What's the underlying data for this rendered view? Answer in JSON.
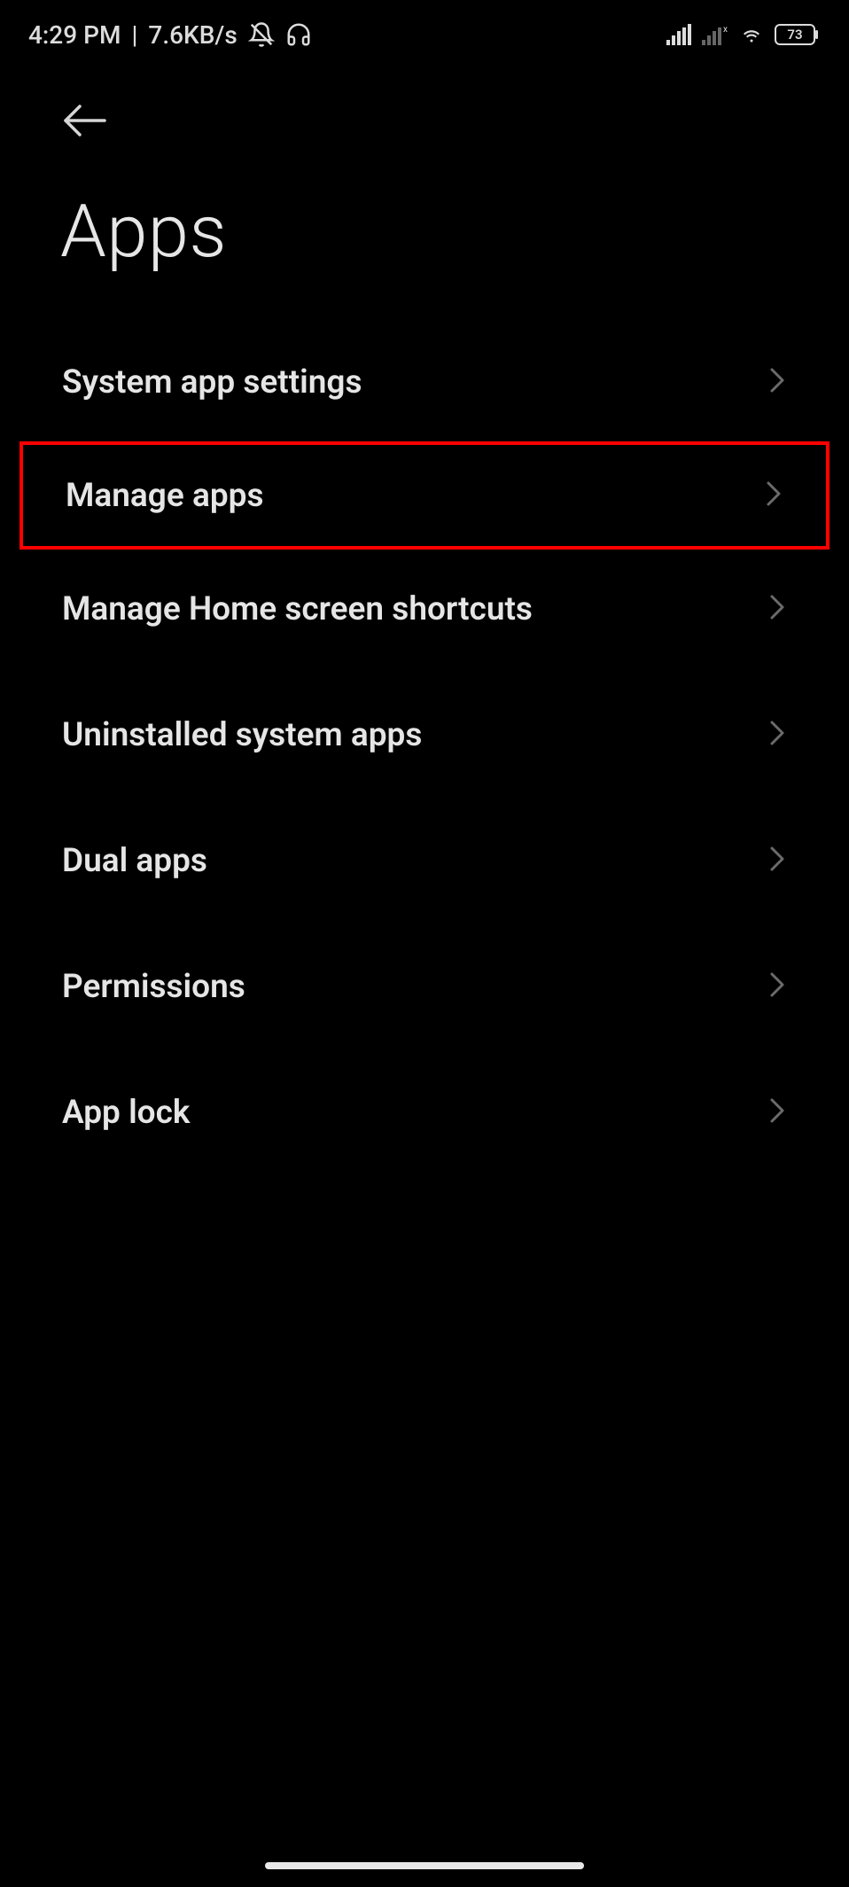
{
  "status_bar": {
    "time": "4:29 PM",
    "network_speed": "7.6KB/s",
    "battery_level": "73"
  },
  "header": {
    "title": "Apps"
  },
  "menu": [
    {
      "label": "System app settings",
      "highlighted": false
    },
    {
      "label": "Manage apps",
      "highlighted": true
    },
    {
      "label": "Manage Home screen shortcuts",
      "highlighted": false
    },
    {
      "label": "Uninstalled system apps",
      "highlighted": false
    },
    {
      "label": "Dual apps",
      "highlighted": false
    },
    {
      "label": "Permissions",
      "highlighted": false
    },
    {
      "label": "App lock",
      "highlighted": false
    }
  ]
}
